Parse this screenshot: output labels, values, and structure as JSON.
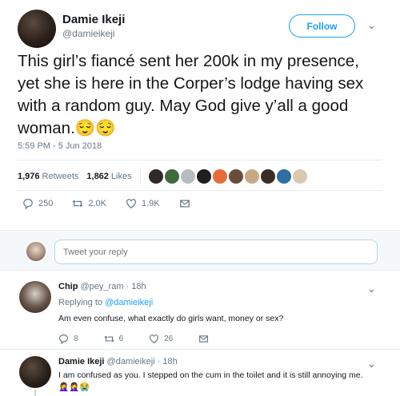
{
  "main_tweet": {
    "author_name": "Damie Ikeji",
    "author_handle": "@damieikeji",
    "follow_label": "Follow",
    "text": "This girl’s fiancé sent her 200k in my presence, yet she is here in the Corper’s lodge having sex with a random guy. May God give y’all a good woman.",
    "emojis": "😌😌",
    "timestamp": "5:59 PM - 5 Jun 2018",
    "retweets_count": "1,976",
    "retweets_label": "Retweets",
    "likes_count": "1,862",
    "likes_label": "Likes",
    "reply_count": "250",
    "retweet_action_count": "2.0K",
    "like_action_count": "1.9K"
  },
  "reply_box": {
    "placeholder": "Tweet your reply"
  },
  "replies": [
    {
      "author_name": "Chip",
      "author_handle": "@pey_ram",
      "time": "· 18h",
      "replying_prefix": "Replying to",
      "replying_to": "@damieikeji",
      "text": "Am even confuse, what exactly do girls want, money or sex?",
      "reply_count": "8",
      "retweet_count": "6",
      "like_count": "26"
    },
    {
      "author_name": "Damie Ikeji",
      "author_handle": "@damieikeji",
      "time": "· 18h",
      "text": "I am confused as you. I stepped on the cum in the toilet and it is still annoying me.",
      "emojis": "🤦‍♀️🤦‍♀️😭"
    }
  ],
  "colors": {
    "accent": "#1da1f2",
    "muted": "#657786",
    "text": "#14171a",
    "border": "#e6ecf0"
  },
  "likers": [
    "#2f2a27",
    "#3d6b3a",
    "#b7bcc1",
    "#1f1f1f",
    "#e86b3a",
    "#6a4c3c",
    "#c8a882",
    "#3b2c24",
    "#2d6ea5",
    "#d9c7b0"
  ]
}
